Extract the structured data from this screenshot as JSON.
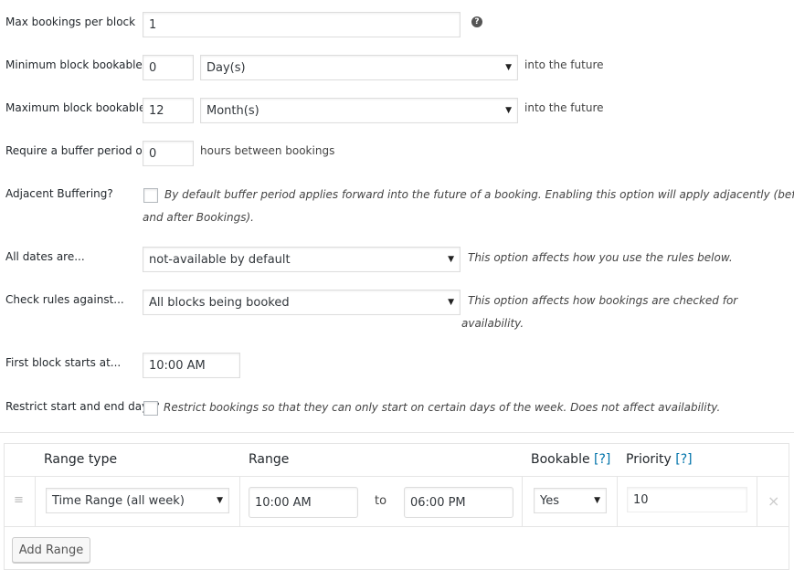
{
  "fields": {
    "max_bookings": {
      "label": "Max bookings per block",
      "value": "1",
      "help_icon": "?"
    },
    "min_block": {
      "label": "Minimum block bookable",
      "value": "0",
      "unit": "Day(s)",
      "suffix": "into the future"
    },
    "max_block": {
      "label": "Maximum block bookable",
      "value": "12",
      "unit": "Month(s)",
      "suffix": "into the future"
    },
    "buffer": {
      "label": "Require a buffer period of",
      "value": "0",
      "suffix": "hours between bookings"
    },
    "adjacent": {
      "label": "Adjacent Buffering?",
      "desc_line1": "By default buffer period applies forward into the future of a booking. Enabling this option will apply adjacently (before",
      "desc_line2": "and after Bookings)."
    },
    "all_dates": {
      "label": "All dates are...",
      "value": "not-available by default",
      "desc": "This option affects how you use the rules below."
    },
    "check_rules": {
      "label": "Check rules against...",
      "value": "All blocks being booked",
      "desc_line1": "This option affects how bookings are checked for",
      "desc_line2": "availability."
    },
    "first_block": {
      "label": "First block starts at...",
      "value": "10:00 AM"
    },
    "restrict": {
      "label": "Restrict start and end days?",
      "desc": "Restrict bookings so that they can only start on certain days of the week. Does not affect availability."
    }
  },
  "table": {
    "headers": {
      "range_type": "Range type",
      "range": "Range",
      "bookable": "Bookable",
      "priority": "Priority",
      "help": "[?]"
    },
    "row": {
      "drag": "≡",
      "range_type": "Time Range (all week)",
      "from": "10:00 AM",
      "to_label": "to",
      "to": "06:00 PM",
      "bookable": "Yes",
      "priority": "10",
      "remove": "×"
    },
    "add_button": "Add Range"
  }
}
